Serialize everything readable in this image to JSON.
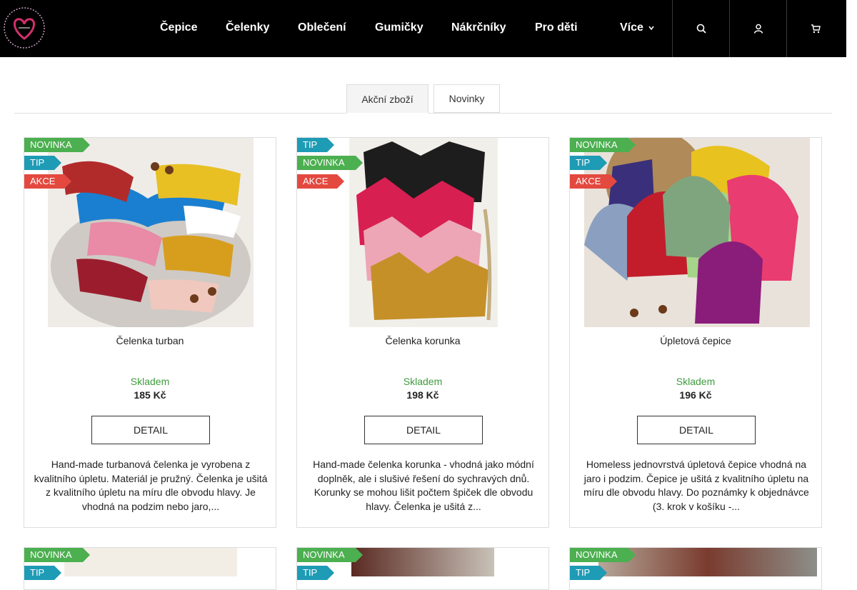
{
  "header": {
    "nav": [
      "Čepice",
      "Čelenky",
      "Oblečení",
      "Gumičky",
      "Nákrčníky",
      "Pro děti"
    ],
    "more_label": "Více",
    "icons": [
      "search-icon",
      "user-icon",
      "cart-icon"
    ]
  },
  "tabs": [
    {
      "label": "Akční zboží",
      "active": true
    },
    {
      "label": "Novinky",
      "active": false
    }
  ],
  "colors": {
    "novinka": "#4caf50",
    "tip": "#1e9bb5",
    "akce": "#e3493f",
    "in_stock": "#3d9b3d",
    "topbar": "#000000"
  },
  "products": [
    {
      "flags": [
        "NOVINKA",
        "TIP",
        "AKCE"
      ],
      "title": "Čelenka turban",
      "stock": "Skladem",
      "price": "185 Kč",
      "button": "DETAIL",
      "description": "Hand-made turbanová čelenka je vyrobena z kvalitního úpletu. Materiál je pružný. Čelenka je ušitá z kvalitního úpletu na míru dle obvodu hlavy. Je vhodná na podzim nebo jaro,..."
    },
    {
      "flags": [
        "TIP",
        "NOVINKA",
        "AKCE"
      ],
      "title": "Čelenka korunka",
      "stock": "Skladem",
      "price": "198 Kč",
      "button": "DETAIL",
      "description": "Hand-made čelenka korunka - vhodná jako módní doplněk, ale i slušivé řešení do sychravých dnů. Korunky se mohou lišit počtem špiček dle obvodu hlavy. Čelenka je ušitá z..."
    },
    {
      "flags": [
        "NOVINKA",
        "TIP",
        "AKCE"
      ],
      "title": "Úpletová čepice",
      "stock": "Skladem",
      "price": "196 Kč",
      "button": "DETAIL",
      "description": "Homeless jednovrstvá úpletová čepice vhodná na jaro i podzim. Čepice je ušitá z kvalitního úpletu na míru dle obvodu hlavy. Do poznámky k objednávce (3. krok v košíku -..."
    }
  ],
  "products_row2": [
    {
      "flags": [
        "NOVINKA",
        "TIP"
      ]
    },
    {
      "flags": [
        "NOVINKA",
        "TIP"
      ]
    },
    {
      "flags": [
        "NOVINKA",
        "TIP"
      ]
    }
  ]
}
